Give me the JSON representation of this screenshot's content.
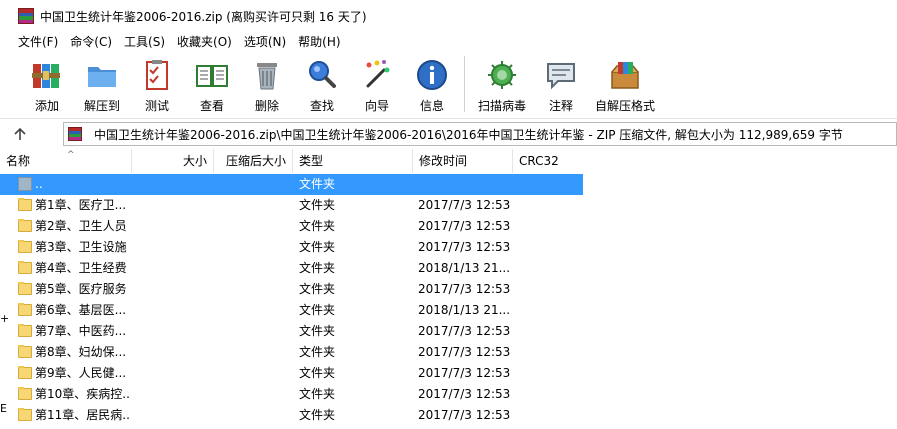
{
  "window": {
    "title": "中国卫生统计年鉴2006-2016.zip (离购买许可只剩 16 天了)"
  },
  "menu": [
    "文件(F)",
    "命令(C)",
    "工具(S)",
    "收藏夹(O)",
    "选项(N)",
    "帮助(H)"
  ],
  "toolbar": {
    "add": "添加",
    "extract": "解压到",
    "test": "测试",
    "view": "查看",
    "delete": "删除",
    "find": "查找",
    "wizard": "向导",
    "info": "信息",
    "virus_scan": "扫描病毒",
    "comment": "注释",
    "sfx": "自解压格式"
  },
  "address": {
    "path": "中国卫生统计年鉴2006-2016.zip\\中国卫生统计年鉴2006-2016\\2016年中国卫生统计年鉴 - ZIP 压缩文件, 解包大小为 112,989,659 字节"
  },
  "columns": {
    "name": "名称",
    "size": "大小",
    "packed": "压缩后大小",
    "type": "类型",
    "modified": "修改时间",
    "crc": "CRC32"
  },
  "rows": [
    {
      "name": "..",
      "type": "文件夹",
      "time": ""
    },
    {
      "name": "第1章、医疗卫...",
      "type": "文件夹",
      "time": "2017/7/3 12:53"
    },
    {
      "name": "第2章、卫生人员",
      "type": "文件夹",
      "time": "2017/7/3 12:53"
    },
    {
      "name": "第3章、卫生设施",
      "type": "文件夹",
      "time": "2017/7/3 12:53"
    },
    {
      "name": "第4章、卫生经费",
      "type": "文件夹",
      "time": "2018/1/13 21..."
    },
    {
      "name": "第5章、医疗服务",
      "type": "文件夹",
      "time": "2017/7/3 12:53"
    },
    {
      "name": "第6章、基层医...",
      "type": "文件夹",
      "time": "2018/1/13 21..."
    },
    {
      "name": "第7章、中医药...",
      "type": "文件夹",
      "time": "2017/7/3 12:53"
    },
    {
      "name": "第8章、妇幼保...",
      "type": "文件夹",
      "time": "2017/7/3 12:53"
    },
    {
      "name": "第9章、人民健...",
      "type": "文件夹",
      "time": "2017/7/3 12:53"
    },
    {
      "name": "第10章、疾病控...",
      "type": "文件夹",
      "time": "2017/7/3 12:53"
    },
    {
      "name": "第11章、居民病...",
      "type": "文件夹",
      "time": "2017/7/3 12:53"
    }
  ],
  "edge_glyphs": [
    "+",
    "E"
  ],
  "colors": {
    "selection": "#3399ff",
    "folder": "#f7d774"
  }
}
